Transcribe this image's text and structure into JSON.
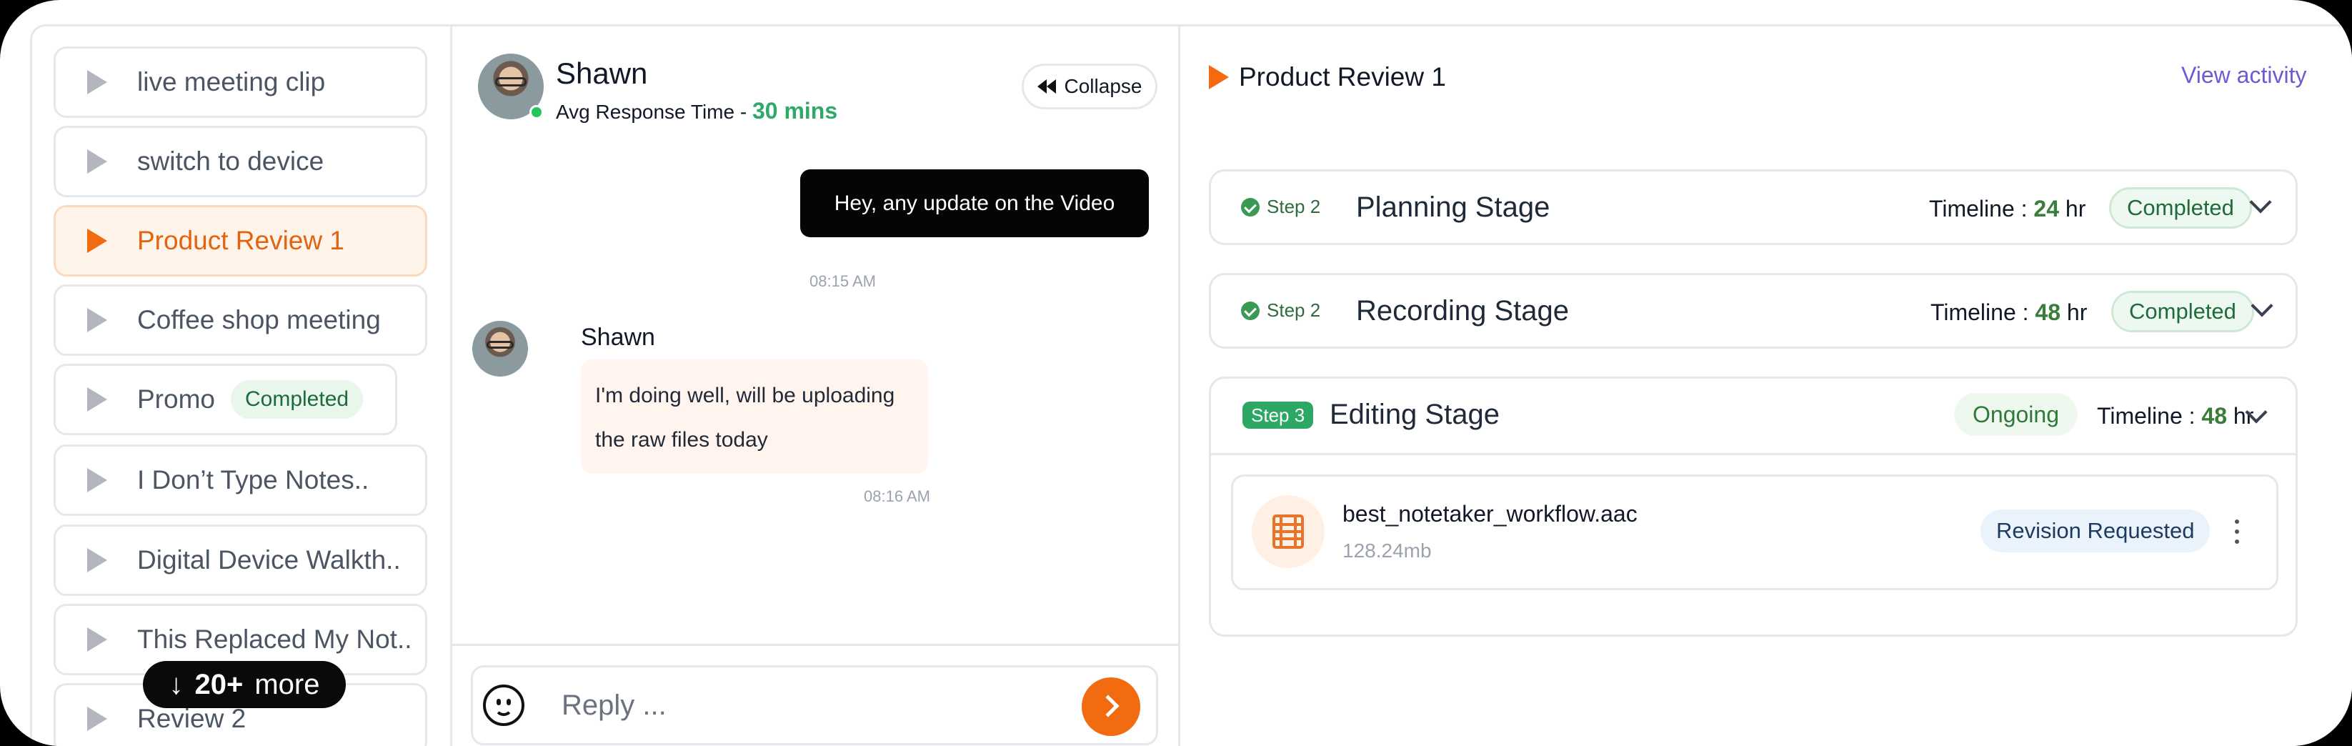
{
  "sidebar": {
    "items": [
      {
        "label": "live meeting clip"
      },
      {
        "label": "switch to device"
      },
      {
        "label": "Product Review 1",
        "active": true
      },
      {
        "label": "Coffee shop meeting"
      },
      {
        "label": "Promo",
        "badge": "Completed"
      },
      {
        "label": "I Don’t Type Notes.."
      },
      {
        "label": "Digital Device Walkth.."
      },
      {
        "label": "This Replaced My Not.."
      },
      {
        "label": "Review 2"
      }
    ],
    "more": {
      "arrow": "↓",
      "count": "20+",
      "text": "more"
    }
  },
  "chat": {
    "contact_name": "Shawn",
    "avg_response_prefix": "Avg Response Time - ",
    "avg_response_value": "30 mins",
    "collapse_label": "Collapse",
    "messages": [
      {
        "direction": "out",
        "text": "Hey, any update on the Video",
        "time": "08:15 AM"
      },
      {
        "direction": "in",
        "sender": "Shawn",
        "text": "I'm doing well, will be uploading the raw files today",
        "time": "08:16 AM"
      }
    ],
    "reply_placeholder": "Reply ..."
  },
  "detail": {
    "title": "Product Review 1",
    "view_activity": "View activity",
    "stages": [
      {
        "step": "Step 2",
        "name": "Planning Stage",
        "timeline_label": "Timeline : ",
        "hours": "24",
        "unit": " hr",
        "status": "Completed"
      },
      {
        "step": "Step 2",
        "name": "Recording Stage",
        "timeline_label": "Timeline : ",
        "hours": "48",
        "unit": " hr",
        "status": "Completed"
      },
      {
        "step": "Step 3",
        "name": "Editing Stage",
        "timeline_label": "Timeline : ",
        "hours": "48",
        "unit": " hr",
        "status": "Ongoing",
        "file": {
          "name": "best_notetaker_workflow.aac",
          "size": "128.24mb",
          "status": "Revision Requested"
        }
      }
    ]
  },
  "colors": {
    "accent": "#f26b11",
    "success": "#2ca864",
    "link": "#6d5bd0"
  }
}
